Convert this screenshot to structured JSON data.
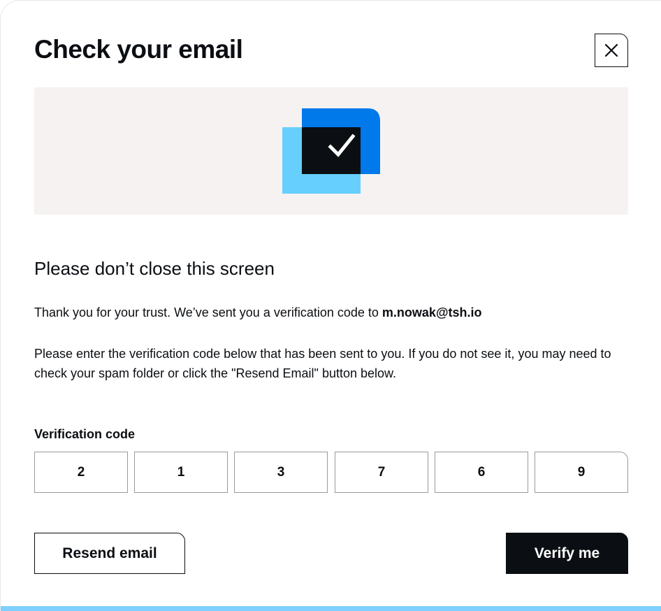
{
  "modal": {
    "title": "Check your email",
    "close_icon": "close-icon"
  },
  "hero": {
    "illustration": "email-check-icon",
    "colors": {
      "background": "#f5f2f1",
      "light_blue": "#66cffe",
      "blue": "#0079ea",
      "dark": "#0b0e12"
    }
  },
  "content": {
    "subtitle": "Please don’t close this screen",
    "sent_text": "Thank you for your trust. We’ve sent you a verification code to ",
    "email": "m.nowak@tsh.io",
    "instructions": "Please enter the verification code below that has been sent to you. If you do not see it, you may need to check your spam folder or click the \"Resend Email\" button below."
  },
  "verification": {
    "label": "Verification code",
    "digits": [
      "2",
      "1",
      "3",
      "7",
      "6",
      "9"
    ]
  },
  "actions": {
    "resend_label": "Resend email",
    "verify_label": "Verify me"
  }
}
